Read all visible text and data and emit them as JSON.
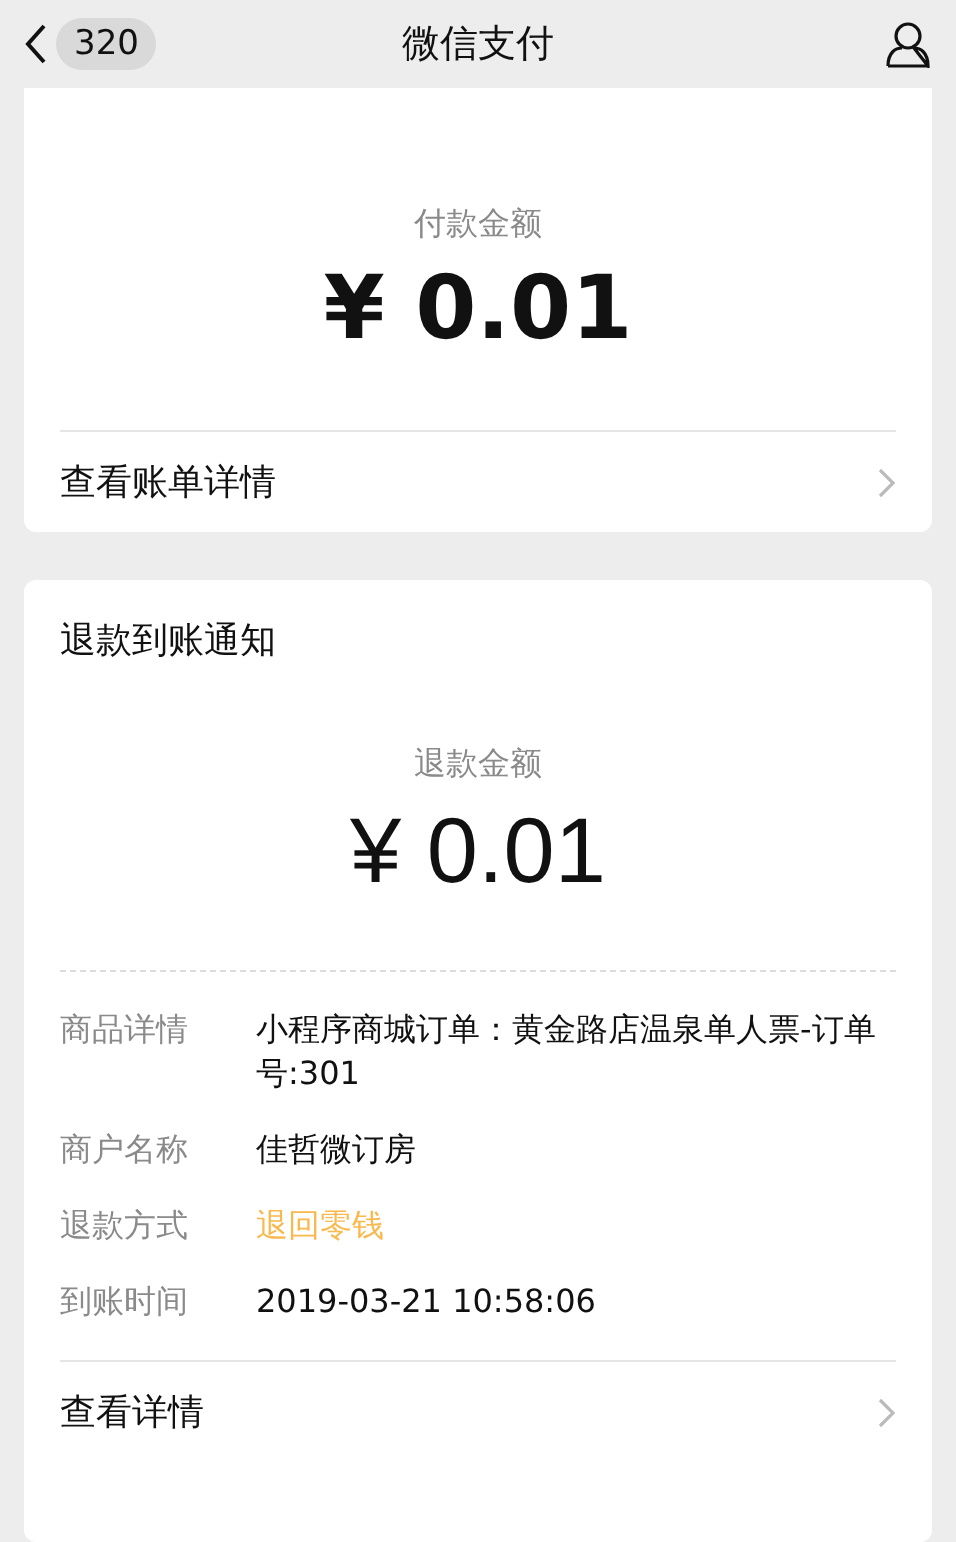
{
  "nav": {
    "back_count": "320",
    "title": "微信支付"
  },
  "payment_card": {
    "amount_label": "付款金额",
    "amount": "¥ 0.01",
    "link": "查看账单详情"
  },
  "refund_card": {
    "title": "退款到账通知",
    "amount_label": "退款金额",
    "amount": "¥ 0.01",
    "rows": [
      {
        "label": "商品详情",
        "value": "小程序商城订单：黄金路店温泉单人票-订单号:301",
        "kind": "normal"
      },
      {
        "label": "商户名称",
        "value": "佳哲微订房",
        "kind": "normal"
      },
      {
        "label": "退款方式",
        "value": "退回零钱",
        "kind": "highlight"
      },
      {
        "label": "到账时间",
        "value": "2019-03-21 10:58:06",
        "kind": "normal"
      }
    ],
    "link": "查看详情"
  }
}
